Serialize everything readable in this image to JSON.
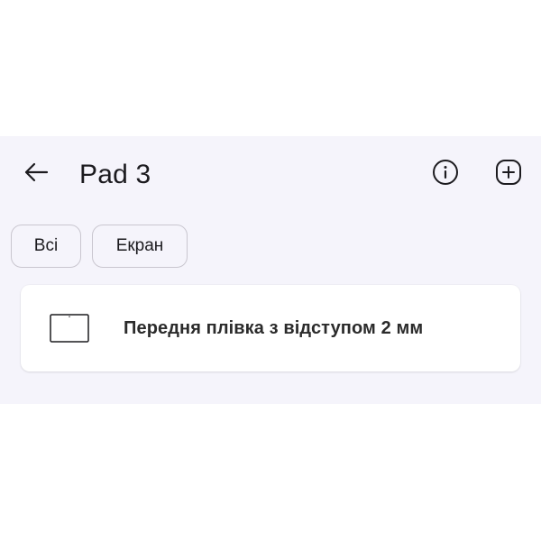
{
  "header": {
    "title": "Pad 3",
    "back_icon": "arrow-left-icon",
    "info_icon": "info-circle-icon",
    "add_icon": "plus-circle-icon"
  },
  "filters": {
    "chips": [
      {
        "label": "Всі"
      },
      {
        "label": "Екран"
      }
    ]
  },
  "items": [
    {
      "icon": "tablet-outline-icon",
      "label": "Передня плівка з відступом 2 мм"
    }
  ],
  "colors": {
    "panel_background": "#f5f4fb",
    "card_background": "#ffffff",
    "text_primary": "#1c1b1f",
    "chip_border": "#c9c6cf"
  }
}
